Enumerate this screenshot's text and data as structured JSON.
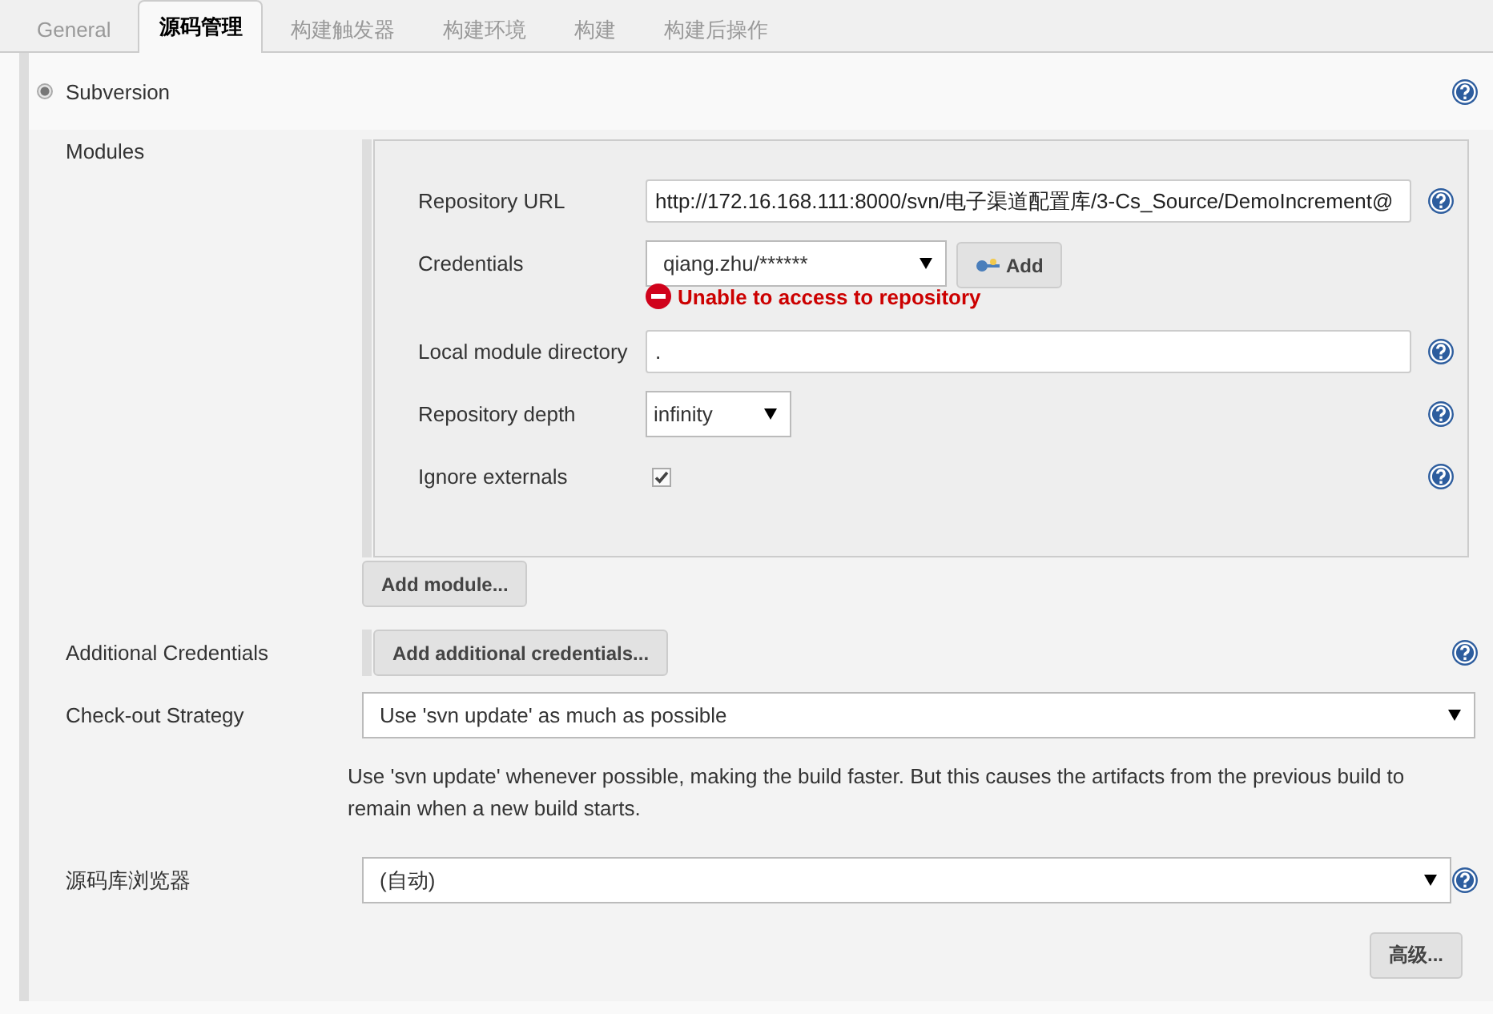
{
  "tabs": [
    {
      "label": "General",
      "selected": false
    },
    {
      "label": "源码管理",
      "selected": true
    },
    {
      "label": "构建触发器",
      "selected": false
    },
    {
      "label": "构建环境",
      "selected": false
    },
    {
      "label": "构建",
      "selected": false
    },
    {
      "label": "构建后操作",
      "selected": false
    }
  ],
  "scm": {
    "label": "Subversion",
    "selected": true
  },
  "modules": {
    "label": "Modules",
    "fields": [
      {
        "kind": "text",
        "label": "Repository URL",
        "value": "http://172.16.168.111:8000/svn/电子渠道配置库/3-Cs_Source/DemoIncrement@"
      },
      {
        "kind": "credentials",
        "label": "Credentials",
        "value": "qiang.zhu/******",
        "button": "Add",
        "error": "Unable to access to repository"
      },
      {
        "kind": "text",
        "label": "Local module directory",
        "value": "."
      },
      {
        "kind": "select",
        "label": "Repository depth",
        "value": "infinity"
      },
      {
        "kind": "checkbox",
        "label": "Ignore externals",
        "checked": true
      }
    ],
    "add_button": "Add module..."
  },
  "additional_credentials": {
    "label": "Additional Credentials",
    "button": "Add additional credentials..."
  },
  "checkout_strategy": {
    "label": "Check-out Strategy",
    "value": "Use 'svn update' as much as possible",
    "description": "Use 'svn update' whenever possible, making the build faster. But this causes the artifacts from the previous build to remain when a new build starts."
  },
  "browser": {
    "label": "源码库浏览器",
    "value": "(自动)"
  },
  "advanced_button": "高级..."
}
